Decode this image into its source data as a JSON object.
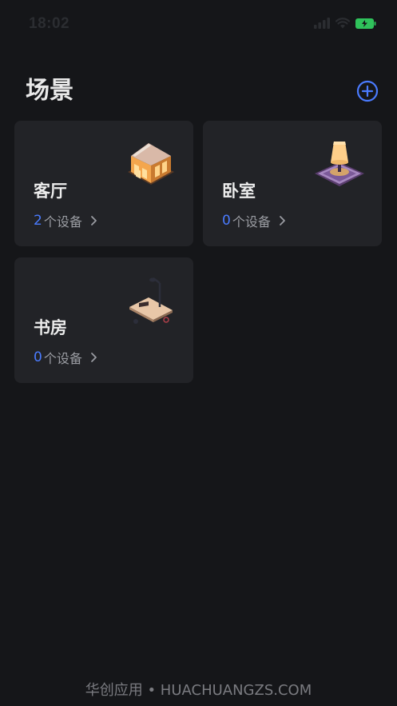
{
  "status_bar": {
    "time": "18:02",
    "icons": [
      "signal-icon",
      "wifi-icon",
      "battery-icon"
    ]
  },
  "page": {
    "title": "场景"
  },
  "header": {
    "add_icon": "add-circle-icon",
    "accent": "#4a7bff"
  },
  "scenes": [
    {
      "name": "客厅",
      "count": "2",
      "count_suffix": "个设备",
      "illustration": "living-room-illustration"
    },
    {
      "name": "卧室",
      "count": "0",
      "count_suffix": "个设备",
      "illustration": "bedroom-illustration"
    },
    {
      "name": "书房",
      "count": "0",
      "count_suffix": "个设备",
      "illustration": "study-illustration"
    }
  ],
  "watermark": "华创应用 • HUACHUANGZS.COM"
}
